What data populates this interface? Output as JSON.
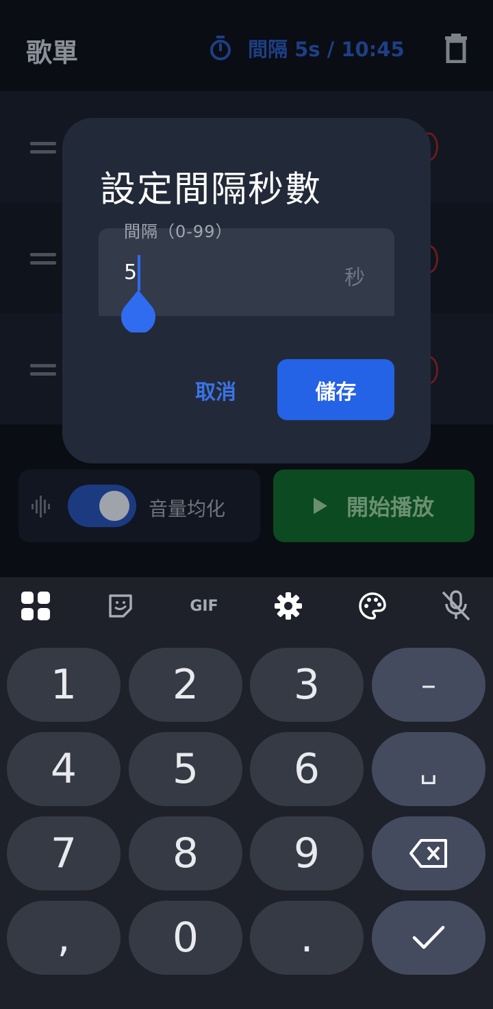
{
  "appbar": {
    "title": "歌單",
    "timer_text": "間隔 5s / 10:45",
    "timer_icon": "stopwatch-icon",
    "delete_icon": "trash-icon"
  },
  "list": {
    "rows": [
      {
        "drag_icon": "drag-handle-icon"
      },
      {
        "drag_icon": "drag-handle-icon"
      },
      {
        "drag_icon": "drag-handle-icon"
      }
    ]
  },
  "controls": {
    "normalize_label": "音量均化",
    "normalize_on": true,
    "play_label": "開始播放"
  },
  "dialog": {
    "title": "設定間隔秒數",
    "field_label": "間隔（0-99）",
    "field_value": "5",
    "field_suffix": "秒",
    "cancel_label": "取消",
    "save_label": "儲存"
  },
  "keyboard": {
    "toolbar": [
      "apps-icon",
      "sticker-icon",
      "GIF",
      "settings-icon",
      "palette-icon",
      "mic-off-icon"
    ],
    "rows": [
      [
        "1",
        "2",
        "3",
        "–"
      ],
      [
        "4",
        "5",
        "6",
        "␣"
      ],
      [
        "7",
        "8",
        "9",
        "⌫"
      ],
      [
        ",",
        "0",
        ".",
        "✓"
      ]
    ]
  },
  "colors": {
    "accent": "#2462e6",
    "dialog_bg": "#222a39",
    "play_bg": "#0c4a21"
  }
}
